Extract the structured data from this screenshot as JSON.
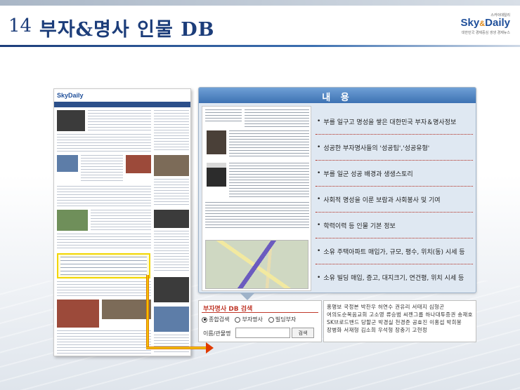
{
  "header": {
    "number": "14",
    "title": "부자&명사 인물 DB"
  },
  "logo": {
    "top": "스카이데일리",
    "brand_sky": "Sky",
    "brand_amp": "&",
    "brand_daily": "Daily",
    "tagline": "대한민국 경제중심 생생 경제뉴스"
  },
  "website_screenshot": {
    "logo_text": "SkyDaily"
  },
  "panel": {
    "title": "내 용",
    "items": [
      "부를 일구고 명성을 쌓은 대한민국 부자＆명사정보",
      "성공한 부자명사들의 '성공팁','성공유형'",
      "부를 일군 성공 배경과 생생스토리",
      "사회적 명성을 이룬 보람과 사회봉사 및 기여",
      "학력이력 등 인물 기본 정보",
      "소유 주택아파트 매입가, 규모, 평수, 위치(동) 시세 등",
      "소유 빌딩 매입, 증고, 대지크기, 연건평, 위치 시세 등"
    ]
  },
  "search": {
    "title": "부자명사 DB 검색",
    "options": [
      {
        "label": "종합검색",
        "selected": true
      },
      {
        "label": "부자명사",
        "selected": false
      },
      {
        "label": "빌딩부자",
        "selected": false
      }
    ],
    "field_label": "이름/관물명",
    "input_value": "",
    "button_label": "검색"
  },
  "names_text": "홍명보 국정본 박찬우 허연수 권유리 서태지 심형곤 여의도순복음교회 고소영 류승범 씨젠그룹 하나대투증권 송재호 SK브로드밴드 당할군 박경실 천경준 공효진 이홍섭 박희봉 장병화 서재형 김소희 우석형 장충기 고현정",
  "colors": {
    "title_blue": "#1c3d7a",
    "panel_header": "#3d72b3",
    "highlight_yellow": "#f2d600",
    "search_red": "#c0392b",
    "arrow_orange": "#e03a00"
  }
}
